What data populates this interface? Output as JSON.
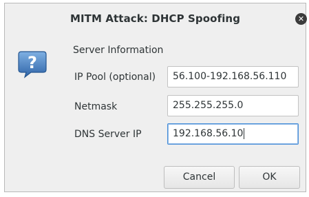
{
  "dialog": {
    "title": "MITM Attack: DHCP Spoofing",
    "close_symbol": "✕",
    "icon": "question-icon",
    "section_label": "Server Information",
    "fields": [
      {
        "label": "IP Pool (optional)",
        "value": "56.100-192.168.56.110"
      },
      {
        "label": "Netmask",
        "value": "255.255.255.0"
      },
      {
        "label": "DNS Server IP",
        "value": "192.168.56.10"
      }
    ],
    "buttons": {
      "cancel": "Cancel",
      "ok": "OK"
    }
  },
  "colors": {
    "dialog_bg": "#efefef",
    "icon_blue": "#3e78b9",
    "focus_border": "#4a90d9"
  }
}
